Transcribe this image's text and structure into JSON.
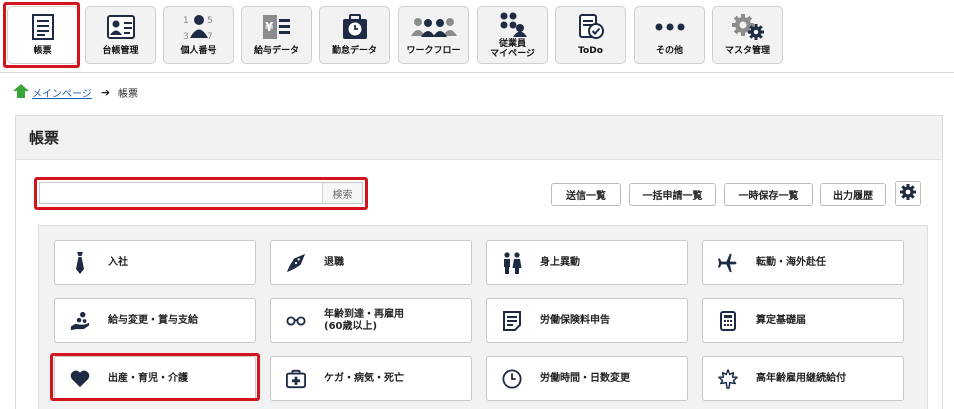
{
  "nav": {
    "items": [
      {
        "label": "帳票",
        "icon": "form-document-icon"
      },
      {
        "label": "台帳管理",
        "icon": "ledger-id-card-icon"
      },
      {
        "label": "個人番号",
        "icon": "personal-number-icon"
      },
      {
        "label": "給与データ",
        "icon": "salary-data-icon"
      },
      {
        "label": "勤怠データ",
        "icon": "attendance-clock-icon"
      },
      {
        "label": "ワークフロー",
        "icon": "workflow-people-icon"
      },
      {
        "label": "従業員\nマイページ",
        "icon": "employee-mypage-icon"
      },
      {
        "label": "ToDo",
        "icon": "todo-check-icon"
      },
      {
        "label": "その他",
        "icon": "more-dots-icon"
      },
      {
        "label": "マスタ管理",
        "icon": "master-settings-gear-icon"
      }
    ]
  },
  "breadcrumb": {
    "home_label": "メインページ",
    "current": "帳票"
  },
  "page": {
    "title": "帳票"
  },
  "search": {
    "value": "",
    "placeholder": "",
    "button_label": "検索"
  },
  "actions": {
    "sent_list": "送信一覧",
    "bulk_apply_list": "一括申請一覧",
    "temp_saved_list": "一時保存一覧",
    "output_history": "出力履歴"
  },
  "forms": [
    {
      "label": "入社",
      "icon": "necktie-icon"
    },
    {
      "label": "退職",
      "icon": "bouquet-icon"
    },
    {
      "label": "身上異動",
      "icon": "couple-icon"
    },
    {
      "label": "転勤・海外赴任",
      "icon": "airplane-icon"
    },
    {
      "label": "給与変更・賞与支給",
      "icon": "hand-coins-icon"
    },
    {
      "label": "年齢到達・再雇用\n(60歳以上)",
      "icon": "glasses-icon"
    },
    {
      "label": "労働保険料申告",
      "icon": "document-lines-icon"
    },
    {
      "label": "算定基礎届",
      "icon": "calculator-icon"
    },
    {
      "label": "出産・育児・介護",
      "icon": "heart-icon"
    },
    {
      "label": "ケガ・病気・死亡",
      "icon": "first-aid-kit-icon"
    },
    {
      "label": "労働時間・日数変更",
      "icon": "clock-icon"
    },
    {
      "label": "高年齢雇用継続給付",
      "icon": "maple-leaf-icon"
    }
  ],
  "colors": {
    "highlight": "#d4141c",
    "link": "#1a5fb4",
    "home_icon": "#3aa53a",
    "icon": "#1f2a44"
  }
}
